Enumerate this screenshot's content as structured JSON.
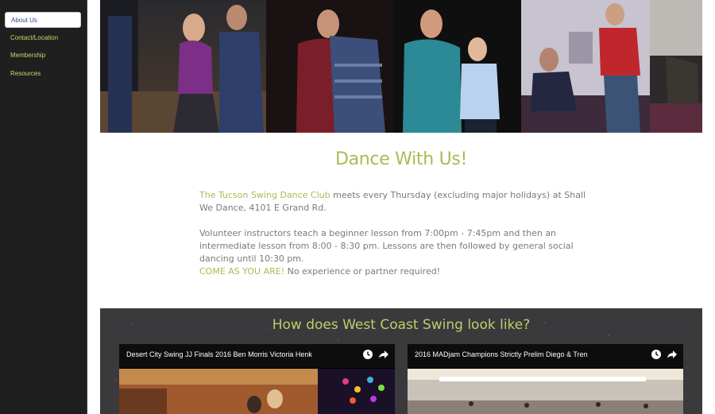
{
  "sidebar": {
    "items": [
      {
        "label": "About Us",
        "active": true
      },
      {
        "label": "Contact/Location",
        "active": false
      },
      {
        "label": "Membership",
        "active": false
      },
      {
        "label": "Resources",
        "active": false
      }
    ]
  },
  "main": {
    "heading": "Dance With Us!",
    "intro": {
      "club_link": "The Tucson Swing Dance Club",
      "text": " meets every Thursday (excluding major holidays) at Shall We Dance, 4101 E Grand Rd."
    },
    "lessons": "Volunteer instructors teach a beginner lesson from 7:00pm - 7:45pm and then an intermediate lesson from 8:00 - 8:30 pm. Lessons are then followed by general social dancing until 10:30 pm.",
    "welcome": {
      "highlight": "COME AS YOU ARE!",
      "text": " No experience or partner required!"
    }
  },
  "videos": {
    "heading": "How does West Coast Swing look like?",
    "items": [
      {
        "title": "Desert City Swing JJ Finals 2016 Ben Morris Victoria Henk"
      },
      {
        "title": "2016 MADjam Champions Strictly Prelim Diego & Tren"
      }
    ]
  },
  "colors": {
    "accent": "#a5bd55",
    "sidebar_bg": "#1f1f1f",
    "nav_text": "#c9d86a",
    "body_text": "#7a7a7a",
    "video_section_bg": "#3a3a3c"
  },
  "icons": {
    "watch_later": "clock-icon",
    "share": "share-icon"
  }
}
